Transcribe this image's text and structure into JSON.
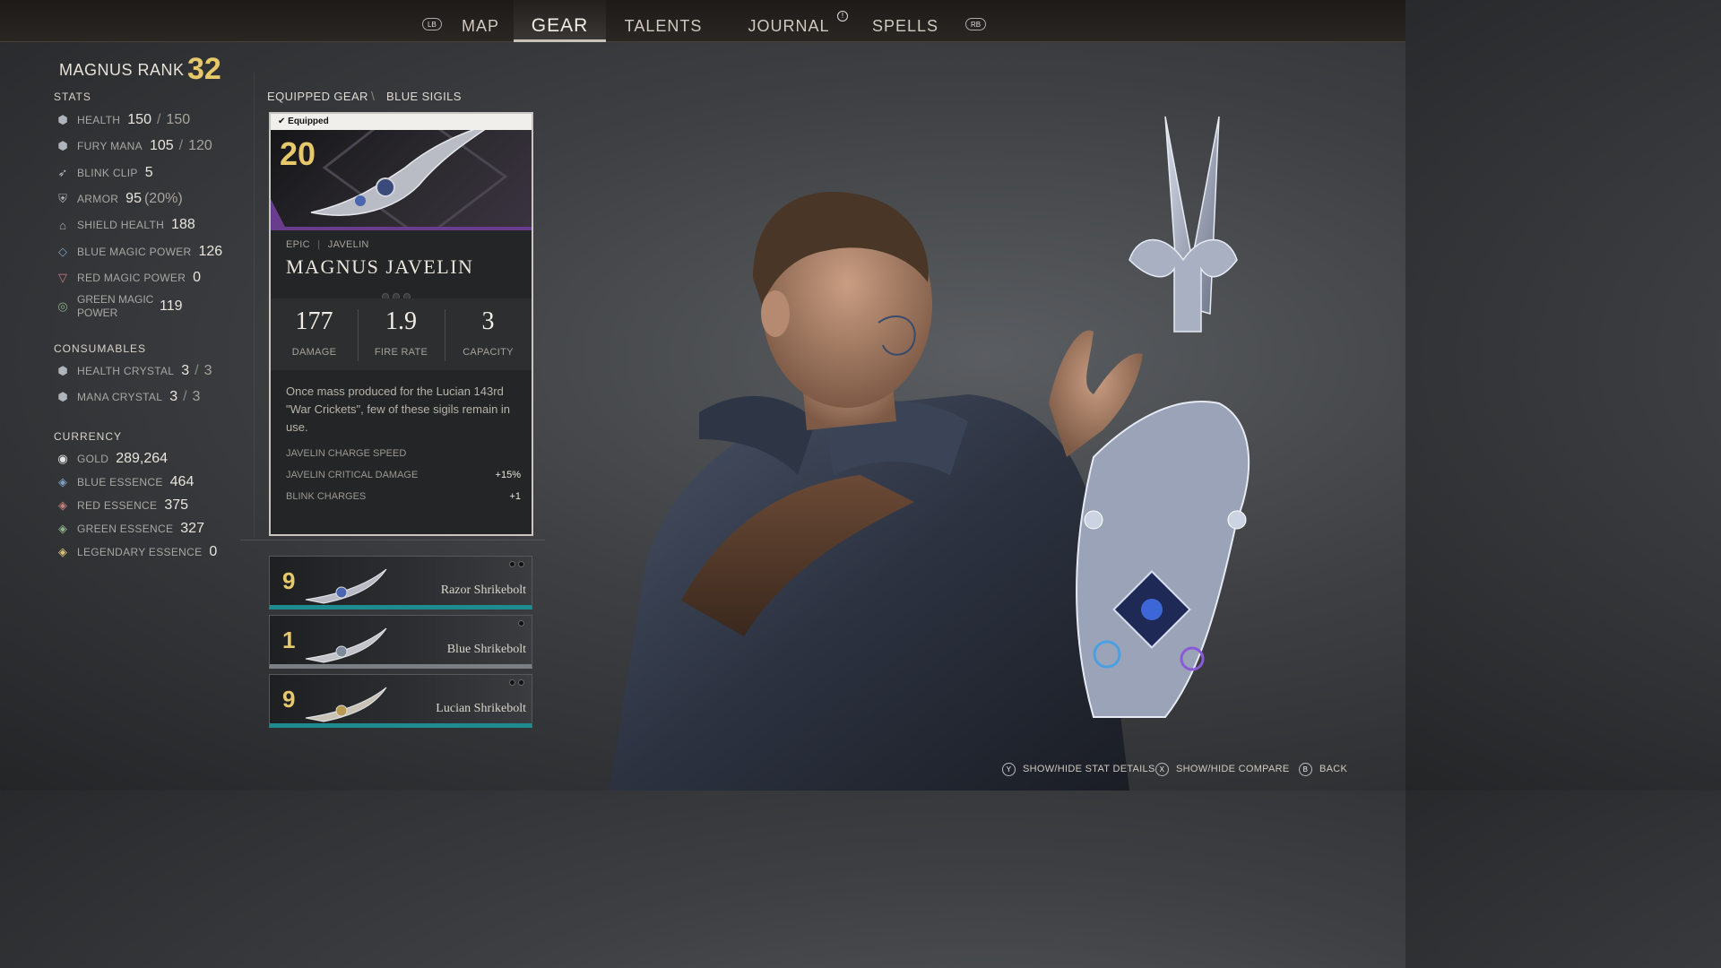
{
  "nav": {
    "left_bumper": "LB",
    "right_bumper": "RB",
    "tabs": [
      {
        "label": "MAP"
      },
      {
        "label": "GEAR"
      },
      {
        "label": "TALENTS"
      },
      {
        "label": "JOURNAL"
      },
      {
        "label": "SPELLS"
      }
    ],
    "active_tab": "GEAR",
    "journal_badge": "!"
  },
  "player": {
    "rank_label": "MAGNUS RANK",
    "rank_value": "32"
  },
  "stats": {
    "heading": "STATS",
    "health": {
      "label": "HEALTH",
      "value": "150",
      "sep": "/",
      "max": "150"
    },
    "fury_mana": {
      "label": "FURY MANA",
      "value": "105",
      "sep": "/",
      "max": "120"
    },
    "blink_clip": {
      "label": "BLINK CLIP",
      "value": "5"
    },
    "armor": {
      "label": "ARMOR",
      "value": "95",
      "pct": "(20%)"
    },
    "shield_health": {
      "label": "SHIELD HEALTH",
      "value": "188"
    },
    "blue_magic_power": {
      "label": "BLUE MAGIC POWER",
      "value": "126"
    },
    "red_magic_power": {
      "label": "RED MAGIC POWER",
      "value": "0"
    },
    "green_magic_power": {
      "label_line1": "GREEN MAGIC",
      "label_line2": "POWER",
      "value": "119"
    }
  },
  "consumables": {
    "heading": "CONSUMABLES",
    "health_crystal": {
      "label": "HEALTH CRYSTAL",
      "value": "3",
      "sep": "/",
      "max": "3"
    },
    "mana_crystal": {
      "label": "MANA CRYSTAL",
      "value": "3",
      "sep": "/",
      "max": "3"
    }
  },
  "currency": {
    "heading": "CURRENCY",
    "gold": {
      "label": "GOLD",
      "value": "289,264"
    },
    "blue_essence": {
      "label": "BLUE ESSENCE",
      "value": "464"
    },
    "red_essence": {
      "label": "RED ESSENCE",
      "value": "375"
    },
    "green_essence": {
      "label": "GREEN ESSENCE",
      "value": "327"
    },
    "legendary_essence": {
      "label": "LEGENDARY ESSENCE",
      "value": "0"
    }
  },
  "breadcrumb": {
    "parent": "EQUIPPED GEAR",
    "separator": "\\",
    "current": "BLUE SIGILS"
  },
  "item_card": {
    "equipped_label": "✔ Equipped",
    "level": "20",
    "rarity": "EPIC",
    "meta_sep": "|",
    "type": "JAVELIN",
    "name": "MAGNUS JAVELIN",
    "rarity_color": "#6a3c8e",
    "stats": [
      {
        "value": "177",
        "label": "DAMAGE"
      },
      {
        "value": "1.9",
        "label": "FIRE RATE"
      },
      {
        "value": "3",
        "label": "CAPACITY"
      }
    ],
    "description": "Once mass produced for the Lucian 143rd \"War Crickets\", few of these sigils remain in use.",
    "perks": [
      {
        "label": "JAVELIN CHARGE SPEED",
        "value": ""
      },
      {
        "label": "JAVELIN CRITICAL DAMAGE",
        "value": "+15%"
      },
      {
        "label": "BLINK CHARGES",
        "value": "+1"
      }
    ]
  },
  "sigil_list": [
    {
      "level": "9",
      "name": "Razor Shrikebolt",
      "rarity_color": "#1f8a8f"
    },
    {
      "level": "1",
      "name": "Blue Shrikebolt",
      "rarity_color": "#7b7e82"
    },
    {
      "level": "9",
      "name": "Lucian Shrikebolt",
      "rarity_color": "#1f8a8f"
    }
  ],
  "hints": [
    {
      "key": "Y",
      "label": "SHOW/HIDE STAT DETAILS"
    },
    {
      "key": "X",
      "label": "SHOW/HIDE COMPARE"
    },
    {
      "key": "B",
      "label": "BACK"
    }
  ],
  "colors": {
    "accent_gold": "#e7c96b",
    "epic_purple": "#6a3c8e",
    "rare_teal": "#1f8a8f"
  }
}
